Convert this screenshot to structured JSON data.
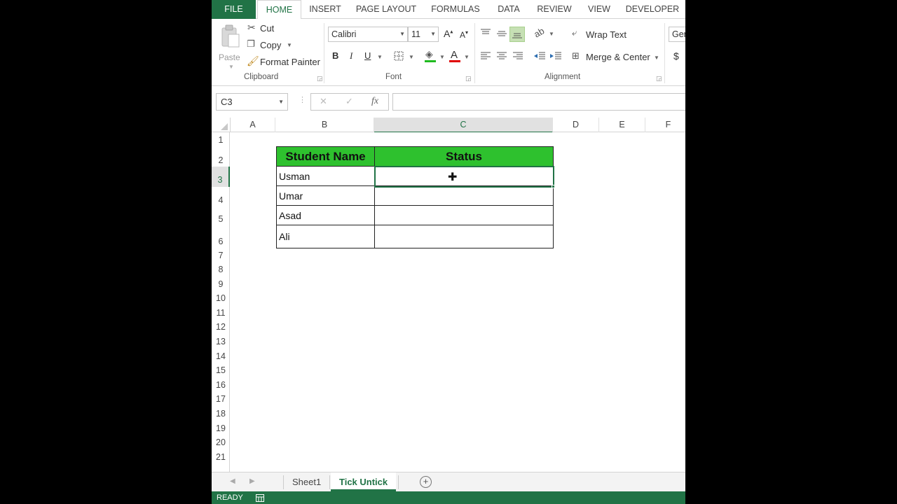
{
  "ribbon": {
    "tabs": [
      "FILE",
      "HOME",
      "INSERT",
      "PAGE LAYOUT",
      "FORMULAS",
      "DATA",
      "REVIEW",
      "VIEW",
      "DEVELOPER"
    ],
    "active_tab": "HOME",
    "clipboard": {
      "paste": "Paste",
      "cut": "Cut",
      "copy": "Copy",
      "format_painter": "Format Painter",
      "label": "Clipboard"
    },
    "font": {
      "name": "Calibri",
      "size": "11",
      "label": "Font",
      "bold": "B",
      "italic": "I",
      "underline": "U"
    },
    "alignment": {
      "wrap_text": "Wrap Text",
      "merge_center": "Merge & Center",
      "label": "Alignment"
    },
    "number": {
      "format": "Gen",
      "currency": "$"
    }
  },
  "formula_bar": {
    "name_box": "C3",
    "fx": "fx",
    "cancel": "✕",
    "enter": "✓",
    "content": ""
  },
  "grid": {
    "columns": [
      "A",
      "B",
      "C",
      "D",
      "E",
      "F"
    ],
    "selected_column": "C",
    "rows": [
      "1",
      "2",
      "3",
      "4",
      "5",
      "6",
      "7",
      "8",
      "9",
      "10",
      "11",
      "12",
      "13",
      "14",
      "15",
      "16",
      "17",
      "18",
      "19",
      "20",
      "21"
    ],
    "selected_row": "3",
    "selected_cell": "C3"
  },
  "table": {
    "headers": [
      "Student Name",
      "Status"
    ],
    "header_color": "#2ec12e",
    "rows": [
      {
        "name": "Usman",
        "status": ""
      },
      {
        "name": "Umar",
        "status": ""
      },
      {
        "name": "Asad",
        "status": ""
      },
      {
        "name": "Ali",
        "status": ""
      }
    ]
  },
  "sheets": {
    "tabs": [
      "Sheet1",
      "Tick Untick"
    ],
    "active": "Tick Untick"
  },
  "status_bar": {
    "mode": "READY"
  },
  "colors": {
    "accent": "#217346"
  }
}
